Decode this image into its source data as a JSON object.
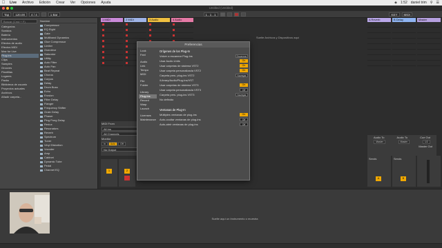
{
  "menubar": {
    "app": "Live",
    "items": [
      "Archivo",
      "Edición",
      "Crear",
      "Ver",
      "Opciones",
      "Ayuda"
    ],
    "clock": "1:52",
    "user": "daniel trim"
  },
  "window": {
    "title": "Untitled (Untitled)"
  },
  "transport": {
    "tap": "Tap",
    "tempo": "120.00",
    "sig": "4 / 4",
    "metro": "1 Bar",
    "position": "1 . 1 . 1",
    "key": "KEY",
    "midi": "MIDI"
  },
  "browser": {
    "search": "Buscar (Cmd + F)",
    "files_header": "Nombre",
    "places": [
      "Categorías",
      "Sonidos",
      "Batería",
      "Instrumentos",
      "Efectos de audio",
      "Efectos MIDI",
      "Max for Live",
      "Plug-ins",
      "Clips",
      "Samples",
      "Grooves",
      "Plantillas",
      "Lugares",
      "Packs",
      "Biblioteca de usuario",
      "Proyectos actuales",
      "Archivos",
      "Añadir carpeta..."
    ],
    "files": [
      "Compressor",
      "EQ Eight",
      "Gate",
      "Multiband Dynamics",
      "Glue Compressor",
      "Limiter",
      "Overdrive",
      "Saturator",
      "Utility",
      "Auto Filter",
      "Auto Pan",
      "Beat Repeat",
      "Chorus",
      "Corpus",
      "Delay",
      "Drum Buss",
      "Echo",
      "Erosion",
      "Filter Delay",
      "Flanger",
      "Frequency Shifter",
      "Grain Delay",
      "Phaser",
      "Ping Pong Delay",
      "Redux",
      "Resonators",
      "Reverb",
      "Spectrum",
      "Tuner",
      "Vinyl Distortion",
      "Vocoder",
      "Amp",
      "Cabinet",
      "Dynamic Tube",
      "Pedal",
      "Channel EQ"
    ]
  },
  "tracks": {
    "left": [
      {
        "name": "1 MIDI",
        "color": "#c98ad8"
      },
      {
        "name": "2 MIDI",
        "color": "#9fb3e6"
      },
      {
        "name": "3 Audio",
        "color": "#f0c040"
      },
      {
        "name": "4 Audio",
        "color": "#e57aa6"
      }
    ],
    "right": [
      {
        "name": "A Reverb",
        "color": "#b9a7e8"
      },
      {
        "name": "B Delay",
        "color": "#8fb3f0"
      },
      {
        "name": "Master",
        "color": "#b6a0df"
      }
    ],
    "drop_hint": "Suelte Archivos y Dispositivos aquí",
    "io": {
      "midi_from": "MIDI From",
      "all_ins": "All Ins",
      "all_channels": "All Channels",
      "monitor": "Monitor",
      "in": "In",
      "auto": "Auto",
      "off": "Off",
      "audio_to": "Audio To",
      "master": "Master",
      "cue_out": "Cue Out",
      "master_out": "Master Out",
      "cue_val": "1/2",
      "master_out_val": "1/2",
      "sends": "Sends",
      "no_output": "No Output"
    }
  },
  "prefs": {
    "title": "Preferencias",
    "tabs": [
      "Look",
      "Feel",
      "Audio",
      "Link",
      "Tempo",
      "MIDI",
      "File",
      "Folder",
      "Library",
      "Plug-Ins",
      "Record",
      "Warp",
      "Launch",
      "Licenses",
      "Maintenance"
    ],
    "active_tab": "Plug-Ins",
    "sections": [
      {
        "title": "Orígenes de los Plug-In",
        "rows": [
          {
            "label": "Volver a escanear Plug-Ins",
            "value": "Escanear",
            "style": "btn"
          },
          {
            "label": "Usar Audio Units",
            "value": "On",
            "style": "on"
          },
          {
            "label": "Usar carpetas de sistema VST2",
            "value": "On",
            "style": "on"
          },
          {
            "label": "Usar carpeta personalizada VST2",
            "value": "On",
            "style": "on"
          },
          {
            "label": "Carpeta pers. plug-ins VST2",
            "value": "Navegar",
            "style": "btn"
          },
          {
            "label": "/Library/Audio/Plug-Ins/VST",
            "value": "",
            "style": "none"
          },
          {
            "label": "Usar carpetas de sistema VST3",
            "value": "On",
            "style": "on"
          },
          {
            "label": "Usar carpeta personalizada VST3",
            "value": "Off",
            "style": "off"
          },
          {
            "label": "Carpeta pers. plug-ins VST3",
            "value": "Navegar",
            "style": "btn"
          },
          {
            "label": "No definido",
            "value": "",
            "style": "none"
          }
        ]
      },
      {
        "title": "Ventanas de Plug-In",
        "rows": [
          {
            "label": "Múltiples ventanas de plug-ins",
            "value": "On",
            "style": "on"
          },
          {
            "label": "Auto-ocultar ventanas de plug-ins",
            "value": "Off",
            "style": "off"
          },
          {
            "label": "Auto-abrir ventanas de plug-ins",
            "value": "Off",
            "style": "off"
          }
        ]
      }
    ]
  },
  "detail": {
    "message": "Suelte aquí un Instrumento o muestra"
  }
}
